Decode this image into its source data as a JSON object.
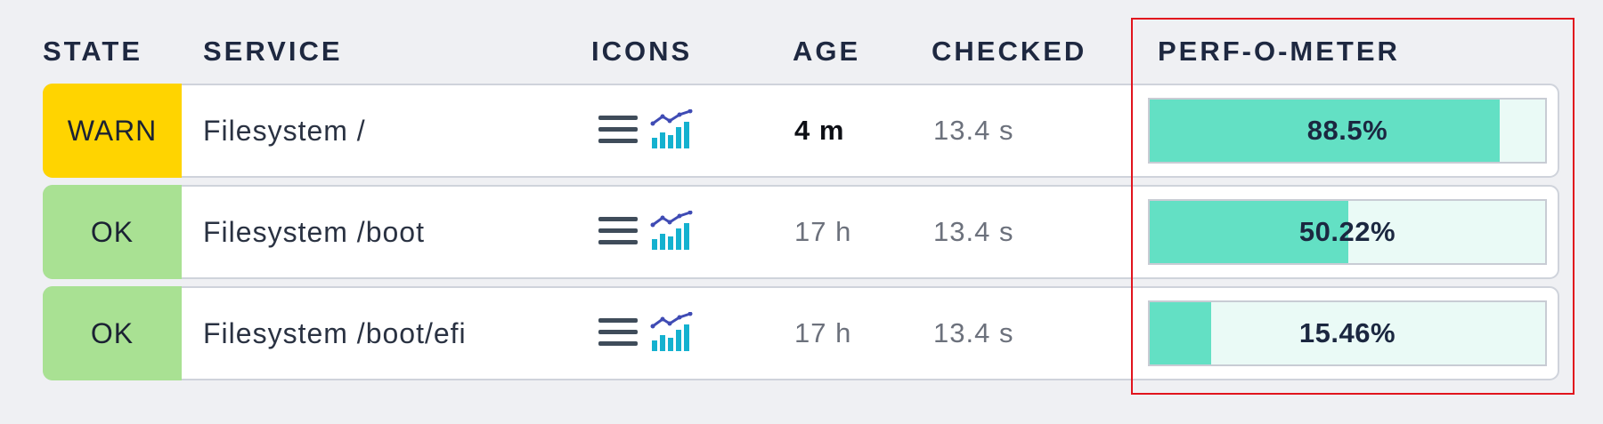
{
  "header": {
    "state": "STATE",
    "service": "SERVICE",
    "icons": "ICONS",
    "age": "AGE",
    "checked": "CHECKED",
    "perf": "PERF-O-METER"
  },
  "rows": [
    {
      "state": "WARN",
      "state_color": "#ffd400",
      "service": "Filesystem /",
      "icons": [
        "menu-icon",
        "graph-icon"
      ],
      "age": "4 m",
      "age_emphasis": true,
      "checked": "13.4 s",
      "perf_label": "88.5%",
      "perf_value": 88.5
    },
    {
      "state": "OK",
      "state_color": "#a9e193",
      "service": "Filesystem /boot",
      "icons": [
        "menu-icon",
        "graph-icon"
      ],
      "age": "17 h",
      "age_emphasis": false,
      "checked": "13.4 s",
      "perf_label": "50.22%",
      "perf_value": 50.22
    },
    {
      "state": "OK",
      "state_color": "#a9e193",
      "service": "Filesystem /boot/efi",
      "icons": [
        "menu-icon",
        "graph-icon"
      ],
      "age": "17 h",
      "age_emphasis": false,
      "checked": "13.4 s",
      "perf_label": "15.46%",
      "perf_value": 15.46
    }
  ],
  "colors": {
    "perf_fill": "#63e0c4",
    "perf_bg": "#eafaf6",
    "highlight": "#e1141d",
    "warn": "#ffd400",
    "ok": "#a9e193"
  }
}
